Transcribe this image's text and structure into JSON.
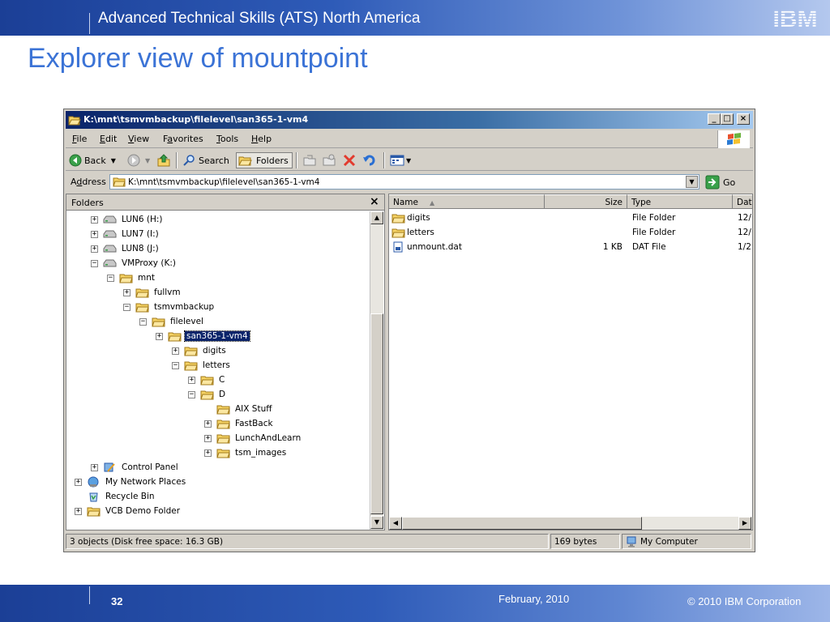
{
  "slide": {
    "header_title": "Advanced Technical Skills (ATS) North America",
    "logo_text": "IBM",
    "title": "Explorer view of mountpoint",
    "page_number": "32",
    "date": "February, 2010",
    "copyright": "© 2010 IBM Corporation",
    "colors": {
      "banner": "#2e5bb8",
      "title": "#3b73d6"
    }
  },
  "window": {
    "title": "K:\\mnt\\tsmvmbackup\\filelevel\\san365-1-vm4",
    "caption_buttons": [
      "_",
      "□",
      "×"
    ],
    "menu": [
      {
        "pre": "",
        "key": "F",
        "post": "ile"
      },
      {
        "pre": "",
        "key": "E",
        "post": "dit"
      },
      {
        "pre": "",
        "key": "V",
        "post": "iew"
      },
      {
        "pre": "F",
        "key": "a",
        "post": "vorites"
      },
      {
        "pre": "",
        "key": "T",
        "post": "ools"
      },
      {
        "pre": "",
        "key": "H",
        "post": "elp"
      }
    ],
    "toolbar": {
      "back": "Back",
      "search": "Search",
      "folders": "Folders"
    },
    "address": {
      "label_pre": "A",
      "label_key": "d",
      "label_post": "dress",
      "value": "K:\\mnt\\tsmvmbackup\\filelevel\\san365-1-vm4",
      "go": "Go"
    },
    "folders_pane": {
      "title": "Folders",
      "close": "×",
      "tree": [
        {
          "label": "LUN6 (H:)",
          "level": 1,
          "exp": "+",
          "icon": "drive-icon"
        },
        {
          "label": "LUN7 (I:)",
          "level": 1,
          "exp": "+",
          "icon": "drive-icon"
        },
        {
          "label": "LUN8 (J:)",
          "level": 1,
          "exp": "+",
          "icon": "drive-icon"
        },
        {
          "label": "VMProxy (K:)",
          "level": 1,
          "exp": "-",
          "icon": "drive-icon"
        },
        {
          "label": "mnt",
          "level": 2,
          "exp": "-",
          "icon": "folder-icon"
        },
        {
          "label": "fullvm",
          "level": 3,
          "exp": "+",
          "icon": "folder-icon"
        },
        {
          "label": "tsmvmbackup",
          "level": 3,
          "exp": "-",
          "icon": "folder-icon"
        },
        {
          "label": "filelevel",
          "level": 4,
          "exp": "-",
          "icon": "folder-icon"
        },
        {
          "label": "san365-1-vm4",
          "level": 5,
          "exp": "+",
          "icon": "folder-icon",
          "selected": true
        },
        {
          "label": "digits",
          "level": 6,
          "exp": "+",
          "icon": "folder-icon"
        },
        {
          "label": "letters",
          "level": 6,
          "exp": "-",
          "icon": "folder-icon"
        },
        {
          "label": "C",
          "level": 7,
          "exp": "+",
          "icon": "folder-icon"
        },
        {
          "label": "D",
          "level": 7,
          "exp": "-",
          "icon": "folder-icon"
        },
        {
          "label": "AIX Stuff",
          "level": 8,
          "exp": "",
          "icon": "folder-icon"
        },
        {
          "label": "FastBack",
          "level": 8,
          "exp": "+",
          "icon": "folder-icon"
        },
        {
          "label": "LunchAndLearn",
          "level": 8,
          "exp": "+",
          "icon": "folder-icon"
        },
        {
          "label": "tsm_images",
          "level": 8,
          "exp": "+",
          "icon": "folder-icon"
        },
        {
          "label": "Control Panel",
          "level": 1,
          "exp": "+",
          "icon": "control-panel-icon"
        },
        {
          "label": "My Network Places",
          "level": 0,
          "exp": "+",
          "icon": "network-icon"
        },
        {
          "label": "Recycle Bin",
          "level": 0,
          "exp": "",
          "icon": "recycle-bin-icon"
        },
        {
          "label": "VCB Demo Folder",
          "level": 0,
          "exp": "+",
          "icon": "folder-icon"
        }
      ]
    },
    "file_list": {
      "columns": [
        "Name",
        "Size",
        "Type",
        "Dat"
      ],
      "rows": [
        {
          "name": "digits",
          "size": "",
          "type": "File Folder",
          "date": "12/",
          "icon": "folder-icon"
        },
        {
          "name": "letters",
          "size": "",
          "type": "File Folder",
          "date": "12/",
          "icon": "folder-icon"
        },
        {
          "name": "unmount.dat",
          "size": "1 KB",
          "type": "DAT File",
          "date": "1/2",
          "icon": "dat-file-icon"
        }
      ]
    },
    "status": {
      "objects": "3 objects (Disk free space: 16.3 GB)",
      "size": "169 bytes",
      "location": "My Computer"
    }
  }
}
